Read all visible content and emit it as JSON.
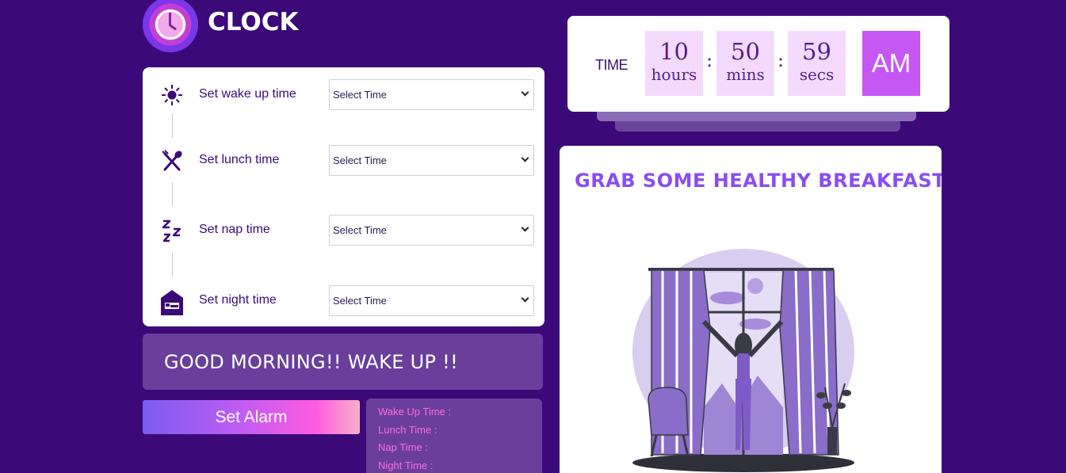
{
  "brand": {
    "name": "CLOCK"
  },
  "settings": {
    "rows": [
      {
        "label": "Set wake up time",
        "icon": "sun-icon",
        "select": "Select Time"
      },
      {
        "label": "Set lunch time",
        "icon": "fork-spoon-icon",
        "select": "Select Time"
      },
      {
        "label": "Set nap time",
        "icon": "zzz-icon",
        "select": "Select Time"
      },
      {
        "label": "Set night time",
        "icon": "bed-house-icon",
        "select": "Select Time"
      }
    ]
  },
  "greeting": "GOOD MORNING!! WAKE UP !!",
  "set_alarm_label": "Set Alarm",
  "summary": {
    "wake": "Wake Up Time :",
    "lunch": "Lunch Time :",
    "nap": "Nap Time :",
    "night": "Night Time :"
  },
  "clock": {
    "label": "TIME",
    "hours": "10",
    "hours_unit": "hours",
    "mins": "50",
    "mins_unit": "mins",
    "secs": "59",
    "secs_unit": "secs",
    "ampm": "AM",
    "separator": ":"
  },
  "message": "GRAB SOME HEALTHY BREAKFAST!!",
  "colors": {
    "background": "#3b0a78",
    "accent": "#c557f3",
    "panel": "#693f9b"
  }
}
